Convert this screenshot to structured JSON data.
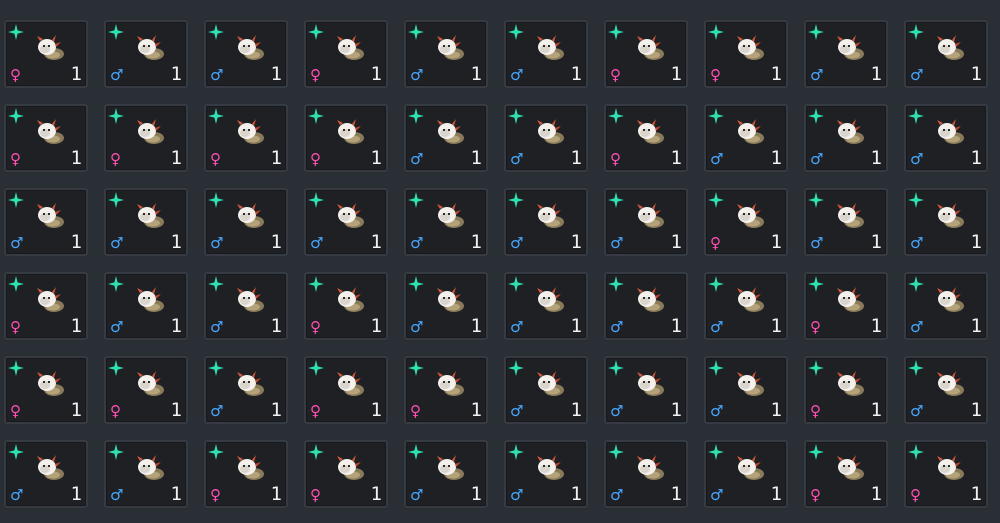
{
  "inventory": {
    "columns": 10,
    "rows": 6,
    "slots": [
      {
        "gender": "♀",
        "gender_type": "female",
        "count": "1",
        "shiny": true
      },
      {
        "gender": "♂",
        "gender_type": "male",
        "count": "1",
        "shiny": true
      },
      {
        "gender": "♂",
        "gender_type": "male",
        "count": "1",
        "shiny": true
      },
      {
        "gender": "♀",
        "gender_type": "female",
        "count": "1",
        "shiny": true
      },
      {
        "gender": "♂",
        "gender_type": "male",
        "count": "1",
        "shiny": true
      },
      {
        "gender": "♂",
        "gender_type": "male",
        "count": "1",
        "shiny": true
      },
      {
        "gender": "♀",
        "gender_type": "female",
        "count": "1",
        "shiny": true
      },
      {
        "gender": "♀",
        "gender_type": "female",
        "count": "1",
        "shiny": true
      },
      {
        "gender": "♂",
        "gender_type": "male",
        "count": "1",
        "shiny": true
      },
      {
        "gender": "♂",
        "gender_type": "male",
        "count": "1",
        "shiny": true
      },
      {
        "gender": "♀",
        "gender_type": "female",
        "count": "1",
        "shiny": true
      },
      {
        "gender": "♀",
        "gender_type": "female",
        "count": "1",
        "shiny": true
      },
      {
        "gender": "♀",
        "gender_type": "female",
        "count": "1",
        "shiny": true
      },
      {
        "gender": "♀",
        "gender_type": "female",
        "count": "1",
        "shiny": true
      },
      {
        "gender": "♂",
        "gender_type": "male",
        "count": "1",
        "shiny": true
      },
      {
        "gender": "♂",
        "gender_type": "male",
        "count": "1",
        "shiny": true
      },
      {
        "gender": "♀",
        "gender_type": "female",
        "count": "1",
        "shiny": true
      },
      {
        "gender": "♂",
        "gender_type": "male",
        "count": "1",
        "shiny": true
      },
      {
        "gender": "♂",
        "gender_type": "male",
        "count": "1",
        "shiny": true
      },
      {
        "gender": "♂",
        "gender_type": "male",
        "count": "1",
        "shiny": true
      },
      {
        "gender": "♂",
        "gender_type": "male",
        "count": "1",
        "shiny": true
      },
      {
        "gender": "♂",
        "gender_type": "male",
        "count": "1",
        "shiny": true
      },
      {
        "gender": "♂",
        "gender_type": "male",
        "count": "1",
        "shiny": true
      },
      {
        "gender": "♂",
        "gender_type": "male",
        "count": "1",
        "shiny": true
      },
      {
        "gender": "♂",
        "gender_type": "male",
        "count": "1",
        "shiny": true
      },
      {
        "gender": "♂",
        "gender_type": "male",
        "count": "1",
        "shiny": true
      },
      {
        "gender": "♂",
        "gender_type": "male",
        "count": "1",
        "shiny": true
      },
      {
        "gender": "♀",
        "gender_type": "female",
        "count": "1",
        "shiny": true
      },
      {
        "gender": "♂",
        "gender_type": "male",
        "count": "1",
        "shiny": true
      },
      {
        "gender": "♂",
        "gender_type": "male",
        "count": "1",
        "shiny": true
      },
      {
        "gender": "♀",
        "gender_type": "female",
        "count": "1",
        "shiny": true
      },
      {
        "gender": "♂",
        "gender_type": "male",
        "count": "1",
        "shiny": true
      },
      {
        "gender": "♂",
        "gender_type": "male",
        "count": "1",
        "shiny": true
      },
      {
        "gender": "♀",
        "gender_type": "female",
        "count": "1",
        "shiny": true
      },
      {
        "gender": "♂",
        "gender_type": "male",
        "count": "1",
        "shiny": true
      },
      {
        "gender": "♂",
        "gender_type": "male",
        "count": "1",
        "shiny": true
      },
      {
        "gender": "♂",
        "gender_type": "male",
        "count": "1",
        "shiny": true
      },
      {
        "gender": "♂",
        "gender_type": "male",
        "count": "1",
        "shiny": true
      },
      {
        "gender": "♀",
        "gender_type": "female",
        "count": "1",
        "shiny": true
      },
      {
        "gender": "♂",
        "gender_type": "male",
        "count": "1",
        "shiny": true
      },
      {
        "gender": "♀",
        "gender_type": "female",
        "count": "1",
        "shiny": true
      },
      {
        "gender": "♀",
        "gender_type": "female",
        "count": "1",
        "shiny": true
      },
      {
        "gender": "♂",
        "gender_type": "male",
        "count": "1",
        "shiny": true
      },
      {
        "gender": "♀",
        "gender_type": "female",
        "count": "1",
        "shiny": true
      },
      {
        "gender": "♀",
        "gender_type": "female",
        "count": "1",
        "shiny": true
      },
      {
        "gender": "♂",
        "gender_type": "male",
        "count": "1",
        "shiny": true
      },
      {
        "gender": "♂",
        "gender_type": "male",
        "count": "1",
        "shiny": true
      },
      {
        "gender": "♂",
        "gender_type": "male",
        "count": "1",
        "shiny": true
      },
      {
        "gender": "♀",
        "gender_type": "female",
        "count": "1",
        "shiny": true
      },
      {
        "gender": "♂",
        "gender_type": "male",
        "count": "1",
        "shiny": true
      },
      {
        "gender": "♂",
        "gender_type": "male",
        "count": "1",
        "shiny": true
      },
      {
        "gender": "♂",
        "gender_type": "male",
        "count": "1",
        "shiny": true
      },
      {
        "gender": "♀",
        "gender_type": "female",
        "count": "1",
        "shiny": true
      },
      {
        "gender": "♀",
        "gender_type": "female",
        "count": "1",
        "shiny": true
      },
      {
        "gender": "♂",
        "gender_type": "male",
        "count": "1",
        "shiny": true
      },
      {
        "gender": "♂",
        "gender_type": "male",
        "count": "1",
        "shiny": true
      },
      {
        "gender": "♂",
        "gender_type": "male",
        "count": "1",
        "shiny": true
      },
      {
        "gender": "♂",
        "gender_type": "male",
        "count": "1",
        "shiny": true
      },
      {
        "gender": "♀",
        "gender_type": "female",
        "count": "1",
        "shiny": true
      },
      {
        "gender": "♀",
        "gender_type": "female",
        "count": "1",
        "shiny": true
      }
    ]
  },
  "icons": {
    "sparkle": "sparkle-icon",
    "creature": "creature-sprite-icon"
  },
  "colors": {
    "background": "#2a2f36",
    "slot_background": "#1e2024",
    "slot_border": "#363b43",
    "sparkle": "#2fe0b0",
    "female": "#ff4fb4",
    "male": "#48a8ff",
    "count_text": "#f2f2f2"
  }
}
